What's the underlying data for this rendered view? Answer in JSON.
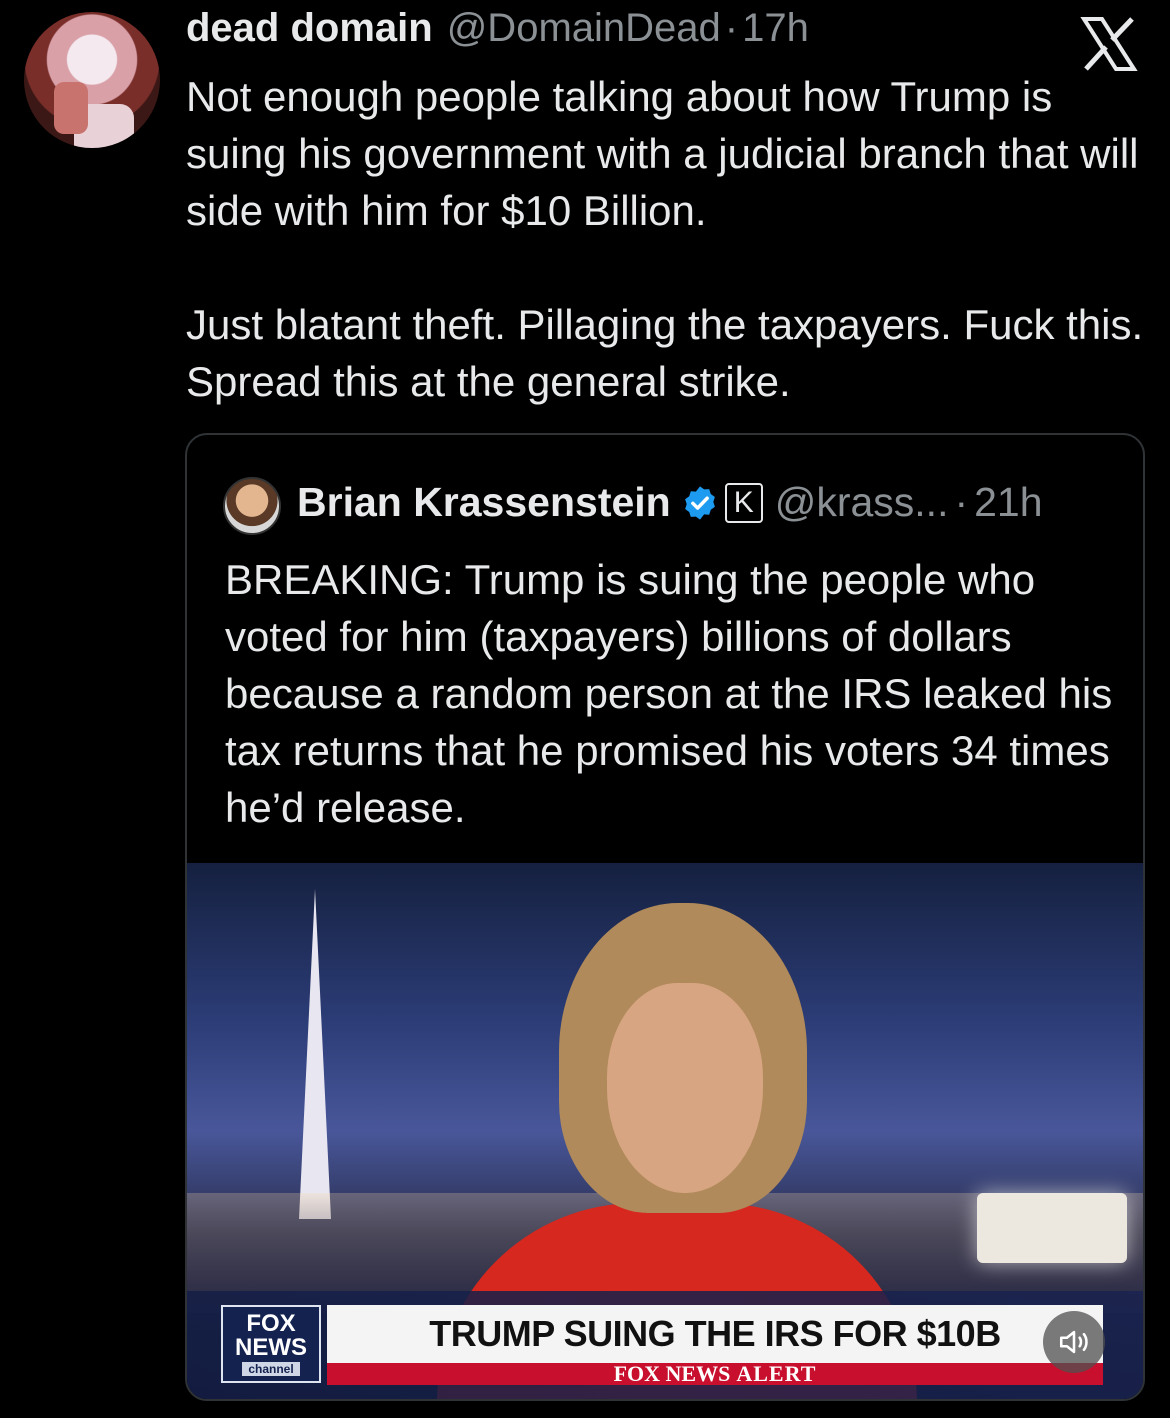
{
  "tweet": {
    "author_name": "dead domain",
    "author_handle": "@DomainDead",
    "separator": "·",
    "time": "17h",
    "paragraph1": "Not enough people talking about how Trump is suing his government with a judicial branch that will side with him for $10 Billion.",
    "paragraph2": "Just blatant theft. Pillaging the taxpayers. Fuck this. Spread this at the general strike."
  },
  "quoted_tweet": {
    "author_name": "Brian Krassenstein",
    "badge_letter": "K",
    "author_handle": "@krass...",
    "separator": "·",
    "time": "21h",
    "text": "BREAKING: Trump is suing the people who voted for him (taxpayers) billions of dollars because a random person at the IRS leaked his tax returns that he promised his voters 34 times he’d release.",
    "media": {
      "headline": "TRUMP SUING THE IRS FOR $10B",
      "alert_prefix": "FOX NEWS",
      "alert_word": "ALERT",
      "logo_line1": "FOX",
      "logo_line2": "NEWS",
      "logo_line3": "channel"
    }
  },
  "colors": {
    "background": "#000000",
    "text_primary": "#e7e9ea",
    "text_secondary": "#8b9095",
    "verified_blue": "#1d9bf0",
    "fox_red": "#c8102e"
  },
  "icons": {
    "platform_logo": "x-logo-icon",
    "verified": "verified-badge-icon",
    "sound": "speaker-icon"
  }
}
